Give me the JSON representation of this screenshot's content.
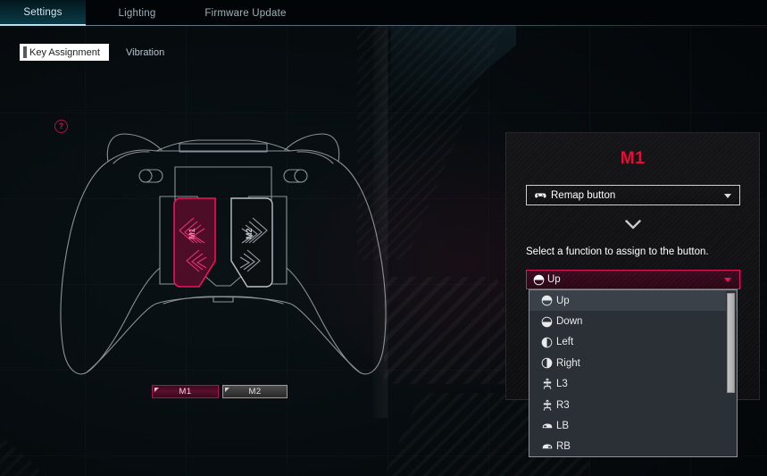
{
  "app": {
    "accent_pink": "#ee0a33",
    "accent_magenta": "#e2145c",
    "background": "#06090b"
  },
  "topbar": {
    "tabs": [
      {
        "label": "Settings",
        "active": true
      },
      {
        "label": "Lighting",
        "active": false
      },
      {
        "label": "Firmware Update",
        "active": false
      }
    ]
  },
  "subtabs": {
    "items": [
      {
        "label": "Key Assignment",
        "active": true
      },
      {
        "label": "Vibration",
        "active": false
      }
    ]
  },
  "help": {
    "glyph": "?",
    "icon": "question-mark-icon"
  },
  "controller": {
    "view": "rear",
    "paddles": [
      {
        "id": "M1",
        "label": "M1",
        "selected": true,
        "color": "#a4164e"
      },
      {
        "id": "M2",
        "label": "M2",
        "selected": false,
        "color": "#9a9a9a"
      }
    ]
  },
  "panel": {
    "title": "M1",
    "action_select": {
      "value": "Remap button",
      "icon": "gamepad-icon",
      "caret": "chevron-down-icon"
    },
    "flow_arrow": "chevron-down-icon",
    "hint": "Select a function to assign to the button.",
    "function_select": {
      "value": "Up",
      "icon": "dpad-up-icon",
      "caret": "chevron-down-icon"
    }
  },
  "dropdown": {
    "open": true,
    "selected_index": 0,
    "options": [
      {
        "label": "Up",
        "icon": "dpad-up-icon"
      },
      {
        "label": "Down",
        "icon": "dpad-down-icon"
      },
      {
        "label": "Left",
        "icon": "dpad-left-icon"
      },
      {
        "label": "Right",
        "icon": "dpad-right-icon"
      },
      {
        "label": "L3",
        "icon": "left-stick-icon"
      },
      {
        "label": "R3",
        "icon": "right-stick-icon"
      },
      {
        "label": "LB",
        "icon": "left-bumper-icon"
      },
      {
        "label": "RB",
        "icon": "right-bumper-icon"
      }
    ]
  }
}
